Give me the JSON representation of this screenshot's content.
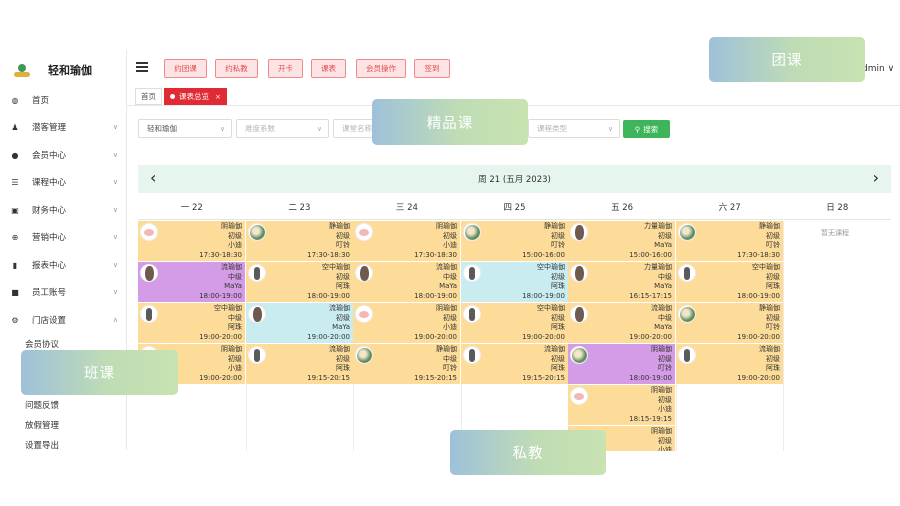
{
  "app": {
    "name": "轻和瑜伽",
    "user": "dmin"
  },
  "sidebar": {
    "items": [
      {
        "label": "首页",
        "icon": "dashboard-icon"
      },
      {
        "label": "潜客管理",
        "icon": "user-plus-icon"
      },
      {
        "label": "会员中心",
        "icon": "user-icon"
      },
      {
        "label": "课程中心",
        "icon": "list-icon"
      },
      {
        "label": "财务中心",
        "icon": "wallet-icon"
      },
      {
        "label": "营销中心",
        "icon": "target-icon"
      },
      {
        "label": "报表中心",
        "icon": "bar-chart-icon"
      },
      {
        "label": "员工账号",
        "icon": "lock-icon"
      },
      {
        "label": "门店设置",
        "icon": "gear-icon"
      }
    ],
    "subitems": [
      "会员协议",
      "问题反馈",
      "放假管理",
      "设置导出"
    ]
  },
  "toolbar": {
    "buttons": [
      "约团课",
      "约私教",
      "开卡",
      "课表",
      "会员操作",
      "签到"
    ]
  },
  "tabs": [
    {
      "label": "首页"
    },
    {
      "label": "课表总览",
      "close": "×"
    }
  ],
  "filters": {
    "store": "轻和瑜伽",
    "difficulty_placeholder": "难度系数",
    "classroom_placeholder": "课堂名称",
    "type_placeholder": "课程类型",
    "search_label": "搜索"
  },
  "calendar": {
    "title": "周 21 (五月 2023)",
    "prev": "‹",
    "next": "›",
    "days": [
      "一 22",
      "二 23",
      "三 24",
      "四 25",
      "五 26",
      "六 27",
      "日 28"
    ],
    "empty_text": "暂无课程",
    "classes": [
      {
        "day": 0,
        "row": 0,
        "name": "阴瑜伽",
        "level": "初级",
        "teacher": "小迪",
        "time": "17:30-18:30",
        "color": "yellow",
        "avatar": "pink"
      },
      {
        "day": 1,
        "row": 0,
        "name": "静瑜伽",
        "level": "初级",
        "teacher": "叮铃",
        "time": "17:30-18:30",
        "color": "yellow",
        "avatar": "green"
      },
      {
        "day": 2,
        "row": 0,
        "name": "阴瑜伽",
        "level": "初级",
        "teacher": "小迪",
        "time": "17:30-18:30",
        "color": "yellow",
        "avatar": "pink"
      },
      {
        "day": 3,
        "row": 0,
        "name": "静瑜伽",
        "level": "初级",
        "teacher": "叮铃",
        "time": "15:00-16:00",
        "color": "yellow",
        "avatar": "green"
      },
      {
        "day": 4,
        "row": 0,
        "name": "力量瑜伽",
        "level": "初级",
        "teacher": "MaYa",
        "time": "15:00-16:00",
        "color": "yellow",
        "avatar": "hair"
      },
      {
        "day": 5,
        "row": 0,
        "name": "静瑜伽",
        "level": "初级",
        "teacher": "叮铃",
        "time": "17:30-18:30",
        "color": "yellow",
        "avatar": "green"
      },
      {
        "day": 0,
        "row": 1,
        "name": "流瑜伽",
        "level": "中级",
        "teacher": "MaYa",
        "time": "18:00-19:00",
        "color": "purple",
        "avatar": "hair"
      },
      {
        "day": 1,
        "row": 1,
        "name": "空中瑜伽",
        "level": "初级",
        "teacher": "阿珠",
        "time": "18:00-19:00",
        "color": "yellow",
        "avatar": "sil"
      },
      {
        "day": 2,
        "row": 1,
        "name": "流瑜伽",
        "level": "中级",
        "teacher": "MaYa",
        "time": "18:00-19:00",
        "color": "yellow",
        "avatar": "hair"
      },
      {
        "day": 3,
        "row": 1,
        "name": "空中瑜伽",
        "level": "初级",
        "teacher": "阿珠",
        "time": "18:00-19:00",
        "color": "cyan",
        "avatar": "sil"
      },
      {
        "day": 4,
        "row": 1,
        "name": "力量瑜伽",
        "level": "中级",
        "teacher": "MaYa",
        "time": "16:15-17:15",
        "color": "yellow",
        "avatar": "hair"
      },
      {
        "day": 5,
        "row": 1,
        "name": "空中瑜伽",
        "level": "初级",
        "teacher": "阿珠",
        "time": "18:00-19:00",
        "color": "yellow",
        "avatar": "sil"
      },
      {
        "day": 0,
        "row": 2,
        "name": "空中瑜伽",
        "level": "中级",
        "teacher": "阿珠",
        "time": "19:00-20:00",
        "color": "yellow",
        "avatar": "sil"
      },
      {
        "day": 1,
        "row": 2,
        "name": "流瑜伽",
        "level": "初级",
        "teacher": "MaYa",
        "time": "19:00-20:00",
        "color": "cyan",
        "avatar": "hair"
      },
      {
        "day": 2,
        "row": 2,
        "name": "阴瑜伽",
        "level": "初级",
        "teacher": "小迪",
        "time": "19:00-20:00",
        "color": "yellow",
        "avatar": "pink"
      },
      {
        "day": 3,
        "row": 2,
        "name": "空中瑜伽",
        "level": "初级",
        "teacher": "阿珠",
        "time": "19:00-20:00",
        "color": "yellow",
        "avatar": "sil"
      },
      {
        "day": 4,
        "row": 2,
        "name": "流瑜伽",
        "level": "中级",
        "teacher": "MaYa",
        "time": "19:00-20:00",
        "color": "yellow",
        "avatar": "hair"
      },
      {
        "day": 5,
        "row": 2,
        "name": "静瑜伽",
        "level": "初级",
        "teacher": "叮铃",
        "time": "19:00-20:00",
        "color": "yellow",
        "avatar": "green"
      },
      {
        "day": 0,
        "row": 3,
        "name": "阴瑜伽",
        "level": "初级",
        "teacher": "小迪",
        "time": "19:00-20:00",
        "color": "yellow",
        "avatar": "pink"
      },
      {
        "day": 1,
        "row": 3,
        "name": "流瑜伽",
        "level": "初级",
        "teacher": "阿珠",
        "time": "19:15-20:15",
        "color": "yellow",
        "avatar": "sil"
      },
      {
        "day": 2,
        "row": 3,
        "name": "静瑜伽",
        "level": "中级",
        "teacher": "叮铃",
        "time": "19:15-20:15",
        "color": "yellow",
        "avatar": "green"
      },
      {
        "day": 3,
        "row": 3,
        "name": "流瑜伽",
        "level": "初级",
        "teacher": "阿珠",
        "time": "19:15-20:15",
        "color": "yellow",
        "avatar": "sil"
      },
      {
        "day": 4,
        "row": 3,
        "name": "阴瑜伽",
        "level": "初级",
        "teacher": "叮铃",
        "time": "18:00-19:00",
        "color": "purple",
        "avatar": "green"
      },
      {
        "day": 5,
        "row": 3,
        "name": "流瑜伽",
        "level": "初级",
        "teacher": "阿珠",
        "time": "19:00-20:00",
        "color": "yellow",
        "avatar": "sil"
      },
      {
        "day": 4,
        "row": 4,
        "name": "阴瑜伽",
        "level": "初级",
        "teacher": "小迪",
        "time": "18:15-19:15",
        "color": "yellow",
        "avatar": "pink"
      },
      {
        "day": 4,
        "row": 5,
        "name": "阴瑜伽",
        "level": "初级",
        "teacher": "小迪",
        "time": "",
        "color": "yellow",
        "avatar": ""
      }
    ]
  },
  "overlays": [
    "团课",
    "精品课",
    "班课",
    "私教"
  ],
  "colors": {
    "accent_red": "#e02a34",
    "search_green": "#3eb55b",
    "class_yellow": "#fcdc98",
    "class_purple": "#d49be6",
    "class_cyan": "#c9ecf1"
  }
}
